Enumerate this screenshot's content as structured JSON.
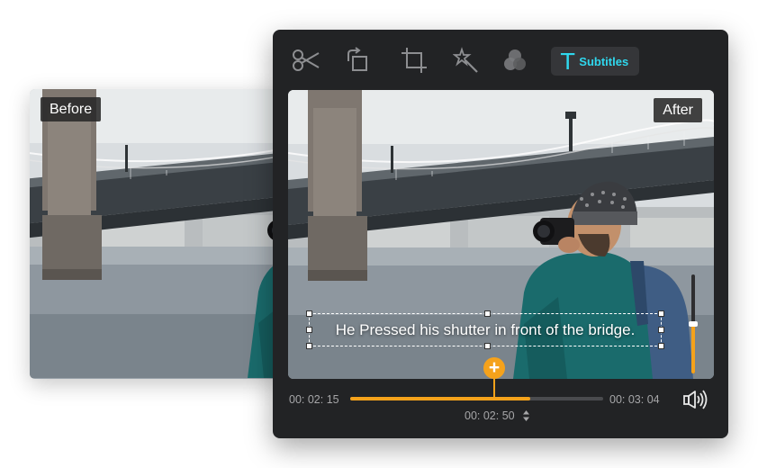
{
  "before_label": "Before",
  "after_label": "After",
  "toolbar": {
    "items": [
      {
        "name": "scissors-icon"
      },
      {
        "name": "rotate-icon"
      },
      {
        "name": "crop-icon"
      },
      {
        "name": "magic-wand-icon"
      },
      {
        "name": "effects-icon"
      }
    ],
    "subtitles_glyph": "T",
    "subtitles_label": "Subtitles"
  },
  "subtitle_text": "He Pressed his shutter in front of the bridge.",
  "timeline": {
    "start_time": "00: 02: 15",
    "end_time": "00: 03: 04",
    "current_time": "00: 02: 50",
    "progress_fraction": 0.71,
    "playhead_glyph": "+"
  },
  "volume_fraction": 0.5,
  "colors": {
    "accent": "#f5a21b",
    "subtitle_accent": "#2fd8ee",
    "panel_bg": "#222325"
  }
}
